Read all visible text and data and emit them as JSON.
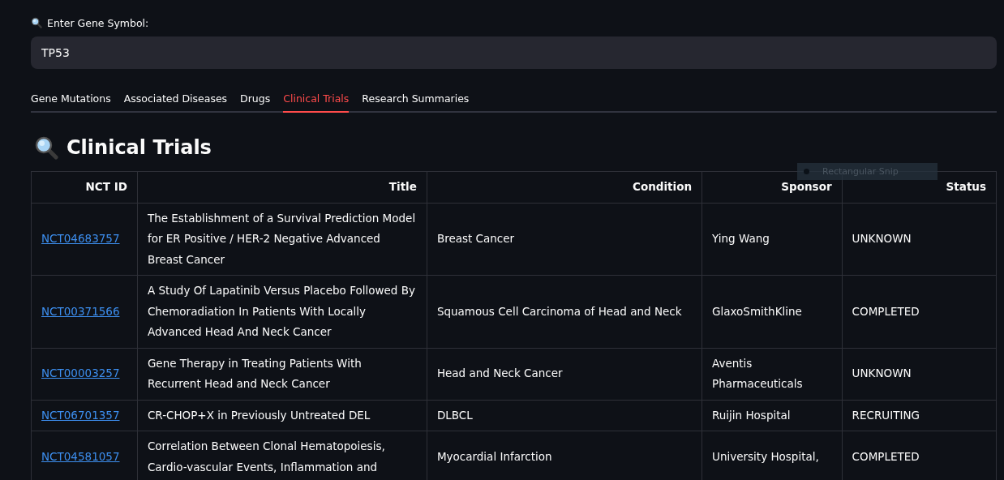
{
  "gene_input": {
    "label": "Enter Gene Symbol:",
    "value": "TP53"
  },
  "tabs": [
    {
      "label": "Gene Mutations",
      "selected": false
    },
    {
      "label": "Associated Diseases",
      "selected": false
    },
    {
      "label": "Drugs",
      "selected": false
    },
    {
      "label": "Clinical Trials",
      "selected": true
    },
    {
      "label": "Research Summaries",
      "selected": false
    }
  ],
  "heading": "Clinical Trials",
  "snip_tooltip": {
    "label": "Rectangular Snip"
  },
  "table": {
    "columns": [
      "NCT ID",
      "Title",
      "Condition",
      "Sponsor",
      "Status"
    ],
    "rows": [
      {
        "nct_id": "NCT04683757",
        "title": "The Establishment of a Survival Prediction Model for ER Positive / HER-2 Negative Advanced Breast Cancer",
        "condition": "Breast Cancer",
        "sponsor": "Ying Wang",
        "status": "UNKNOWN"
      },
      {
        "nct_id": "NCT00371566",
        "title": "A Study Of Lapatinib Versus Placebo Followed By Chemoradiation In Patients With Locally Advanced Head And Neck Cancer",
        "condition": "Squamous Cell Carcinoma of Head and Neck",
        "sponsor": "GlaxoSmithKline",
        "status": "COMPLETED"
      },
      {
        "nct_id": "NCT00003257",
        "title": "Gene Therapy in Treating Patients With Recurrent Head and Neck Cancer",
        "condition": "Head and Neck Cancer",
        "sponsor": "Aventis Pharmaceuticals",
        "status": "UNKNOWN"
      },
      {
        "nct_id": "NCT06701357",
        "title": "CR-CHOP+X in Previously Untreated DEL",
        "condition": "DLBCL",
        "sponsor": "Ruijin Hospital",
        "status": "RECRUITING"
      },
      {
        "nct_id": "NCT04581057",
        "title": "Correlation Between Clonal Hematopoiesis, Cardio-vascular Events, Inflammation and",
        "condition": "Myocardial Infarction",
        "sponsor": "University Hospital,",
        "status": "COMPLETED"
      }
    ]
  }
}
